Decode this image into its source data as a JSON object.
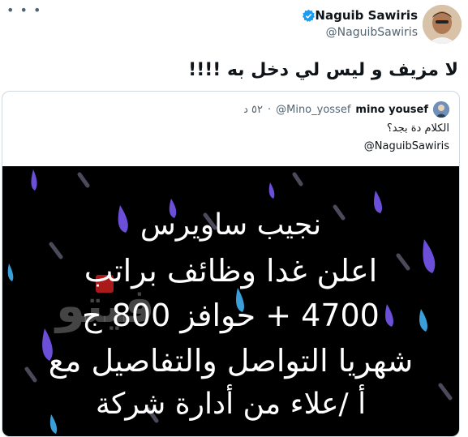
{
  "tweet": {
    "author_name": "Naguib Sawiris",
    "author_handle": "@NaguibSawiris",
    "text": "لا مزيف و ليس لي دخل به !!!!"
  },
  "quoted": {
    "author_name": "mino yousef",
    "author_handle": "@Mino_yossef",
    "time": "٥٢ د",
    "separator": "·",
    "text": "الكلام دة بجد؟",
    "mention": "@NaguibSawiris"
  },
  "media_text": {
    "line1": "نجيب ساويرس",
    "line2": "اعلن غدا وظائف براتب",
    "line3": "4700 + حوافز 800 ج",
    "line4": "شهريا التواصل والتفاصيل مع",
    "line5": "أ /علاء من أدارة شركة"
  },
  "colors": {
    "verified": "#1d9bf0",
    "rain_purple": "#6b4fd8",
    "rain_blue": "#3a9fd8"
  }
}
